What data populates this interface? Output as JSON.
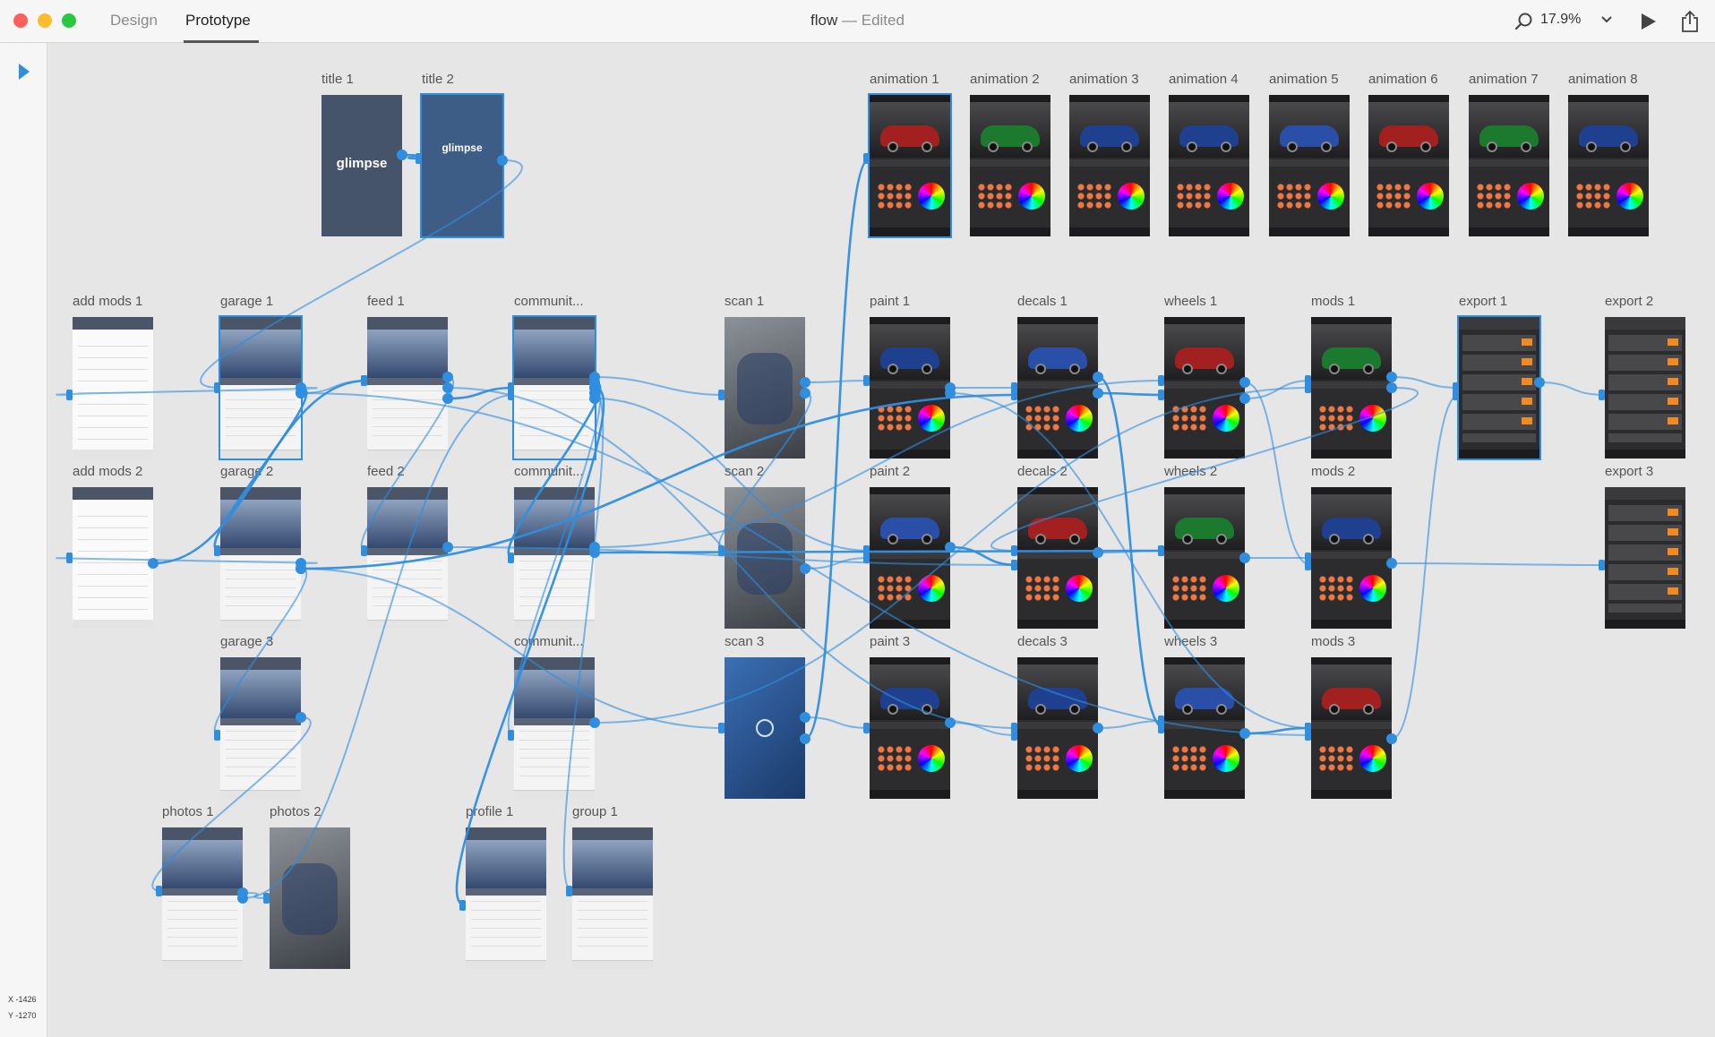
{
  "window": {
    "tabs": [
      "Design",
      "Prototype"
    ],
    "active_tab": "Prototype",
    "doc_name": "flow",
    "doc_status": "— Edited",
    "zoom": "17.9%",
    "icons": [
      "search-icon",
      "chevron-down-icon",
      "play-icon",
      "share-icon",
      "select-arrow-icon"
    ]
  },
  "coords": {
    "x_label": "X",
    "x_value": "-1426",
    "y_label": "Y",
    "y_value": "-1270"
  },
  "accent_color": "#2f8ee0",
  "artboards": [
    {
      "label": "title 1",
      "kind": "title",
      "logo": "glimpse"
    },
    {
      "label": "title 2",
      "kind": "title",
      "logo": "glimpse"
    },
    {
      "label": "animation 1",
      "kind": "car"
    },
    {
      "label": "animation 2",
      "kind": "car"
    },
    {
      "label": "animation 3",
      "kind": "car"
    },
    {
      "label": "animation 4",
      "kind": "car"
    },
    {
      "label": "animation 5",
      "kind": "car"
    },
    {
      "label": "animation 6",
      "kind": "car"
    },
    {
      "label": "animation 7",
      "kind": "car"
    },
    {
      "label": "animation 8",
      "kind": "car"
    },
    {
      "label": "add mods 1",
      "kind": "light"
    },
    {
      "label": "garage 1",
      "kind": "app"
    },
    {
      "label": "feed 1",
      "kind": "app"
    },
    {
      "label": "communit...",
      "kind": "app"
    },
    {
      "label": "scan 1",
      "kind": "scan"
    },
    {
      "label": "paint 1",
      "kind": "car"
    },
    {
      "label": "decals 1",
      "kind": "car"
    },
    {
      "label": "wheels 1",
      "kind": "car"
    },
    {
      "label": "mods 1",
      "kind": "car"
    },
    {
      "label": "export 1",
      "kind": "export"
    },
    {
      "label": "export 2",
      "kind": "export"
    },
    {
      "label": "add mods 2",
      "kind": "light"
    },
    {
      "label": "garage 2",
      "kind": "app"
    },
    {
      "label": "feed 2",
      "kind": "app"
    },
    {
      "label": "communit...",
      "kind": "app"
    },
    {
      "label": "scan 2",
      "kind": "scan"
    },
    {
      "label": "paint 2",
      "kind": "car"
    },
    {
      "label": "decals 2",
      "kind": "car"
    },
    {
      "label": "wheels 2",
      "kind": "car"
    },
    {
      "label": "mods 2",
      "kind": "car"
    },
    {
      "label": "export 3",
      "kind": "export"
    },
    {
      "label": "garage 3",
      "kind": "app"
    },
    {
      "label": "communit...",
      "kind": "app"
    },
    {
      "label": "scan 3",
      "kind": "scan-blue"
    },
    {
      "label": "paint 3",
      "kind": "car"
    },
    {
      "label": "decals 3",
      "kind": "car"
    },
    {
      "label": "wheels 3",
      "kind": "car"
    },
    {
      "label": "mods 3",
      "kind": "car"
    },
    {
      "label": "photos 1",
      "kind": "app"
    },
    {
      "label": "photos 2",
      "kind": "scan"
    },
    {
      "label": "profile 1",
      "kind": "app"
    },
    {
      "label": "group 1",
      "kind": "app"
    }
  ],
  "links": [
    [
      0,
      1
    ],
    [
      1,
      11
    ],
    [
      11,
      10
    ],
    [
      11,
      12
    ],
    [
      12,
      13
    ],
    [
      13,
      14
    ],
    [
      14,
      15
    ],
    [
      15,
      16
    ],
    [
      16,
      17
    ],
    [
      17,
      18
    ],
    [
      18,
      19
    ],
    [
      19,
      20
    ],
    [
      11,
      22
    ],
    [
      22,
      21
    ],
    [
      22,
      31
    ],
    [
      12,
      23
    ],
    [
      13,
      24
    ],
    [
      13,
      32
    ],
    [
      14,
      25
    ],
    [
      25,
      26
    ],
    [
      26,
      27
    ],
    [
      27,
      28
    ],
    [
      28,
      29
    ],
    [
      29,
      30
    ],
    [
      33,
      2
    ],
    [
      33,
      34
    ],
    [
      34,
      35
    ],
    [
      35,
      36
    ],
    [
      36,
      37
    ],
    [
      37,
      19
    ],
    [
      31,
      38
    ],
    [
      38,
      39
    ],
    [
      13,
      40
    ],
    [
      13,
      41
    ],
    [
      22,
      33
    ],
    [
      23,
      27
    ],
    [
      24,
      28
    ],
    [
      12,
      35
    ],
    [
      11,
      37
    ],
    [
      13,
      26
    ],
    [
      16,
      36
    ],
    [
      17,
      29
    ],
    [
      18,
      27
    ],
    [
      15,
      37
    ],
    [
      22,
      16
    ],
    [
      24,
      17
    ],
    [
      32,
      18
    ],
    [
      38,
      13
    ],
    [
      21,
      12
    ]
  ]
}
